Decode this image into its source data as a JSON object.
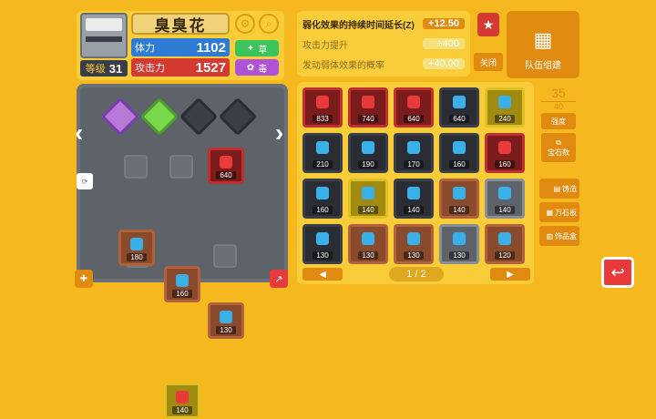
{
  "pokemon": {
    "name": "臭臭花",
    "level_label": "等级",
    "level": "31",
    "hp_label": "体力",
    "hp": "1102",
    "atk_label": "攻击力",
    "atk": "1527",
    "type1": "草",
    "type2": "毒"
  },
  "bonuses": [
    {
      "label": "弱化效果的持续时间延长(Z)",
      "value": "+12.50",
      "active": true
    },
    {
      "label": "攻击力提升",
      "value": "+400",
      "active": false
    },
    {
      "label": "发动弱体效果的概率",
      "value": "+40.00",
      "active": false
    }
  ],
  "buttons": {
    "close": "关闭",
    "team_bonus": "队伍组建",
    "capacity": "35",
    "capacity_max": "40",
    "sort": "强度",
    "gem_count": "宝石数",
    "craft": "铸造",
    "all_stones": "万石板",
    "decorate": "饰品盒",
    "page": "1 / 2"
  },
  "board": {
    "slots": [
      {
        "value": "640",
        "color": "red"
      },
      {
        "value": "180",
        "color": "brown"
      },
      {
        "value": "160",
        "color": "brown"
      },
      {
        "value": "130",
        "color": "brown"
      },
      {
        "value": "140",
        "color": "gold"
      }
    ]
  },
  "inventory": [
    {
      "value": "833",
      "color": "red"
    },
    {
      "value": "740",
      "color": "red"
    },
    {
      "value": "640",
      "color": "red"
    },
    {
      "value": "640",
      "color": "dark"
    },
    {
      "value": "240",
      "color": "gold"
    },
    {
      "value": "210",
      "color": "dark"
    },
    {
      "value": "190",
      "color": "dark"
    },
    {
      "value": "170",
      "color": "dark"
    },
    {
      "value": "160",
      "color": "dark"
    },
    {
      "value": "160",
      "color": "red"
    },
    {
      "value": "160",
      "color": "dark"
    },
    {
      "value": "140",
      "color": "gold"
    },
    {
      "value": "140",
      "color": "dark"
    },
    {
      "value": "140",
      "color": "brown"
    },
    {
      "value": "140",
      "color": "grey"
    },
    {
      "value": "130",
      "color": "dark"
    },
    {
      "value": "130",
      "color": "brown"
    },
    {
      "value": "130",
      "color": "brown"
    },
    {
      "value": "130",
      "color": "grey"
    },
    {
      "value": "120",
      "color": "brown"
    }
  ]
}
